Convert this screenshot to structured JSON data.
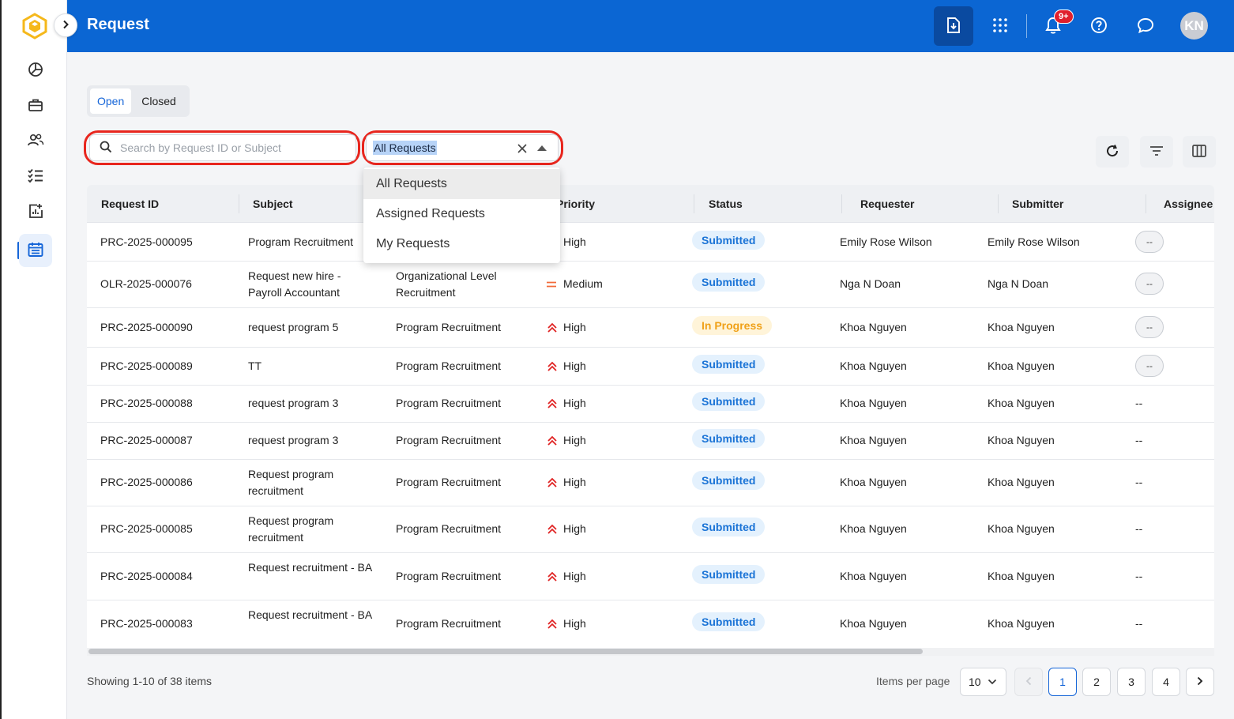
{
  "header": {
    "title": "Request",
    "notification_count": "9+",
    "avatar_initials": "KN",
    "brand_color": "#0b66d3"
  },
  "sidebar": {
    "items": [
      {
        "icon": "dashboard-pie-icon"
      },
      {
        "icon": "briefcase-icon"
      },
      {
        "icon": "people-icon"
      },
      {
        "icon": "checklist-icon"
      },
      {
        "icon": "report-chart-icon"
      },
      {
        "icon": "calendar-request-icon",
        "active": true
      }
    ]
  },
  "tabs": [
    {
      "label": "Open",
      "active": true
    },
    {
      "label": "Closed",
      "active": false
    }
  ],
  "search": {
    "placeholder": "Search by Request ID or Subject",
    "value": ""
  },
  "filter_select": {
    "value": "All Requests",
    "options": [
      "All Requests",
      "Assigned Requests",
      "My Requests"
    ]
  },
  "table": {
    "columns": [
      "Request ID",
      "Subject",
      "Priority",
      "Status",
      "Requester",
      "Submitter",
      "Assignee"
    ],
    "rows": [
      {
        "id": "PRC-2025-000095",
        "subject": "Program Recruitment",
        "type": "",
        "priority": "High",
        "status": "Submitted",
        "requester": "Emily Rose Wilson",
        "submitter": "Emily Rose Wilson",
        "assignee": "--"
      },
      {
        "id": "OLR-2025-000076",
        "subject": "Request new hire - Payroll Accountant",
        "type": "Organizational Level Recruitment",
        "priority": "Medium",
        "status": "Submitted",
        "requester": "Nga N Doan",
        "submitter": "Nga N Doan",
        "assignee": "--"
      },
      {
        "id": "PRC-2025-000090",
        "subject": "request program 5",
        "type": "Program Recruitment",
        "priority": "High",
        "status": "In Progress",
        "requester": "Khoa Nguyen",
        "submitter": "Khoa Nguyen",
        "assignee": "--"
      },
      {
        "id": "PRC-2025-000089",
        "subject": "TT",
        "type": "Program Recruitment",
        "priority": "High",
        "status": "Submitted",
        "requester": "Khoa Nguyen",
        "submitter": "Khoa Nguyen",
        "assignee": "--"
      },
      {
        "id": "PRC-2025-000088",
        "subject": "request program 3",
        "type": "Program Recruitment",
        "priority": "High",
        "status": "Submitted",
        "requester": "Khoa Nguyen",
        "submitter": "Khoa Nguyen",
        "assignee": "--"
      },
      {
        "id": "PRC-2025-000087",
        "subject": "request program 3",
        "type": "Program Recruitment",
        "priority": "High",
        "status": "Submitted",
        "requester": "Khoa Nguyen",
        "submitter": "Khoa Nguyen",
        "assignee": "--"
      },
      {
        "id": "PRC-2025-000086",
        "subject": "Request program recruitment",
        "type": "Program Recruitment",
        "priority": "High",
        "status": "Submitted",
        "requester": "Khoa Nguyen",
        "submitter": "Khoa Nguyen",
        "assignee": "--"
      },
      {
        "id": "PRC-2025-000085",
        "subject": "Request program recruitment",
        "type": "Program Recruitment",
        "priority": "High",
        "status": "Submitted",
        "requester": "Khoa Nguyen",
        "submitter": "Khoa Nguyen",
        "assignee": "--"
      },
      {
        "id": "PRC-2025-000084",
        "subject": "Request recruitment - BA",
        "type": "Program Recruitment",
        "priority": "High",
        "status": "Submitted",
        "requester": "Khoa Nguyen",
        "submitter": "Khoa Nguyen",
        "assignee": "--"
      },
      {
        "id": "PRC-2025-000083",
        "subject": "Request recruitment - BA",
        "type": "Program Recruitment",
        "priority": "High",
        "status": "Submitted",
        "requester": "Khoa Nguyen",
        "submitter": "Khoa Nguyen",
        "assignee": "--"
      }
    ]
  },
  "footer": {
    "showing": "Showing 1-10 of 38 items",
    "items_per_page_label": "Items per page",
    "items_per_page_value": "10",
    "pages": [
      "1",
      "2",
      "3",
      "4"
    ],
    "current_page": "1"
  }
}
